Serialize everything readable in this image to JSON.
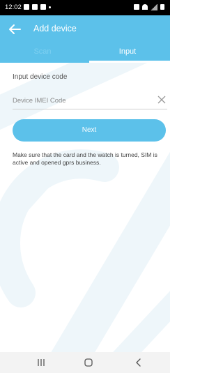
{
  "status_bar": {
    "time": "12:02",
    "left_icons": [
      "image-icon",
      "voicemail-icon",
      "video-icon",
      "dot-icon"
    ],
    "right_icons": [
      "alarm-icon",
      "wifi-icon",
      "signal-icon",
      "battery-icon"
    ]
  },
  "header": {
    "back_icon": "arrow-left-icon",
    "title": "Add device"
  },
  "tabs": [
    {
      "label": "Scan",
      "active": false
    },
    {
      "label": "Input",
      "active": true
    }
  ],
  "form": {
    "label": "Input device code",
    "input_value": "",
    "input_placeholder": "Device IMEI Code",
    "clear_icon": "close-icon",
    "next_label": "Next",
    "notice": "Make sure that the card and the watch is turned, SIM is active and opened gprs business."
  },
  "nav_bar": {
    "icons": [
      "recent-apps-icon",
      "home-icon",
      "back-icon"
    ]
  },
  "colors": {
    "accent": "#5cc1ea",
    "status_bar": "#000000",
    "inactive_tab": "#7dd0f1",
    "nav_bar": "#f3f3f3"
  }
}
